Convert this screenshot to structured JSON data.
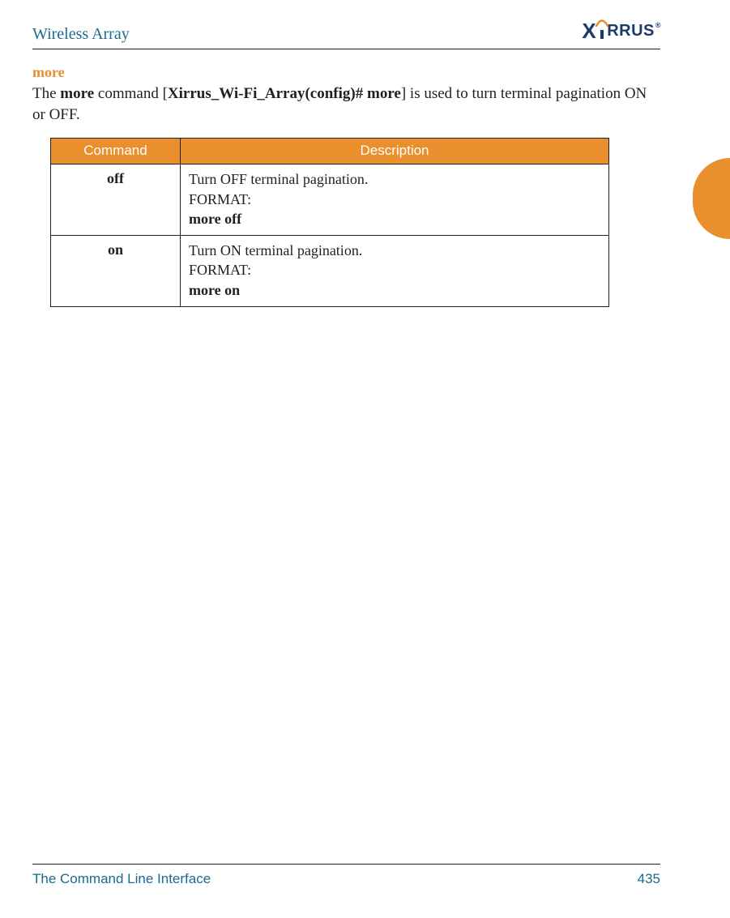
{
  "header": {
    "title": "Wireless Array",
    "logo_text_prefix": "X",
    "logo_text_suffix": "RRUS"
  },
  "section": {
    "heading": "more",
    "body_prefix": "The ",
    "body_cmd": "more",
    "body_mid1": " command [",
    "body_prompt": "Xirrus_Wi-Fi_Array(config)# more",
    "body_mid2": "] is used to turn terminal pagination ON or OFF."
  },
  "table": {
    "headers": {
      "command": "Command",
      "description": "Description"
    },
    "rows": [
      {
        "command": "off",
        "desc_line1": "Turn OFF terminal pagination.",
        "desc_line2": "FORMAT:",
        "desc_line3": "more off"
      },
      {
        "command": "on",
        "desc_line1": "Turn ON terminal pagination.",
        "desc_line2": "FORMAT:",
        "desc_line3": "more on"
      }
    ]
  },
  "footer": {
    "section_title": "The Command Line Interface",
    "page_number": "435"
  }
}
